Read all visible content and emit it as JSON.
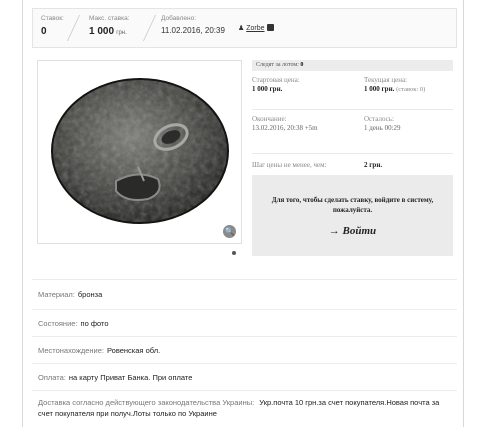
{
  "stats": {
    "bids_label": "Ставок:",
    "bids_value": "0",
    "max_bid_label": "Макс. ставка:",
    "max_bid_amount": "1 000",
    "max_bid_currency": "грн.",
    "added_label": "Добавлено:",
    "added_value": "11.02.2016, 20:39"
  },
  "seller": {
    "name": "Zorbe"
  },
  "image": {
    "alt": "Монета (бронза)"
  },
  "panel": {
    "watchers_label": "Следят за лотом:",
    "watchers_value": "0",
    "start_price_label": "Стартовая цена:",
    "start_price_value": "1 000 грн.",
    "current_price_label": "Текущая цена:",
    "current_price_value": "1 000 грн.",
    "current_price_note": "(ставок: 0)",
    "end_label": "Окончание:",
    "end_value": "13.02.2016, 20:38 +5m",
    "left_label": "Осталось:",
    "left_value": "1 день 00:29",
    "step_label": "Шаг цены не менее, чем:",
    "step_value": "2 грн.",
    "login_message": "Для того, чтобы сделать ставку, войдите в систему, пожалуйста.",
    "login_button": "→ Войти"
  },
  "details": [
    {
      "key": "Материал:",
      "value": "бронза"
    },
    {
      "key": "Состояние:",
      "value": "по фото"
    },
    {
      "key": "Местонахождение:",
      "value": "Ровенская обл."
    },
    {
      "key": "Оплата:",
      "value": "на карту Приват Банка. При оплате"
    }
  ],
  "delivery": {
    "key": "Доставка согласно действующего законодательства Украины:",
    "value": "Укр.почта 10 грн.за счет покупателя.Новая почта за счет покупателя при получ.Лоты только по Украине"
  }
}
